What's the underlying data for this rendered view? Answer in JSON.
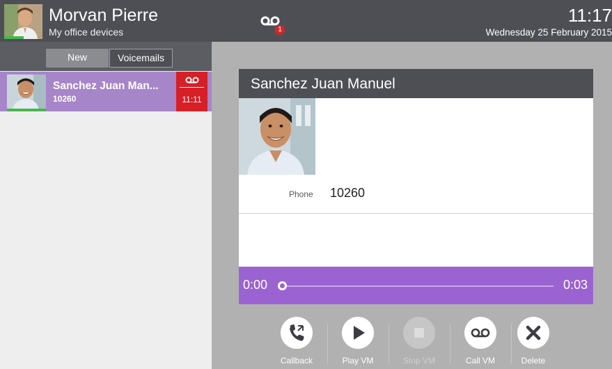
{
  "header": {
    "user_name": "Morvan Pierre",
    "user_subtitle": "My office devices",
    "voicemail_count": "1",
    "time": "11:17",
    "date": "Wednesday 25 February 2015"
  },
  "tabs": [
    {
      "label": "New",
      "selected": false
    },
    {
      "label": "Voicemails",
      "selected": true
    }
  ],
  "voicemail_list": [
    {
      "name": "Sanchez Juan Man...",
      "number": "10260",
      "time": "11:11"
    }
  ],
  "detail": {
    "title": "Sanchez Juan Manuel",
    "phone_label": "Phone",
    "phone_value": "10260"
  },
  "player": {
    "start_time": "0:00",
    "end_time": "0:03",
    "progress": 0
  },
  "actions": [
    {
      "label": "Callback",
      "icon": "callback-icon",
      "enabled": true
    },
    {
      "label": "Play VM",
      "icon": "play-icon",
      "enabled": true
    },
    {
      "label": "Stop VM",
      "icon": "stop-icon",
      "enabled": false
    },
    {
      "label": "Call VM",
      "icon": "voicemail-icon",
      "enabled": true
    },
    {
      "label": "Delete",
      "icon": "close-icon",
      "enabled": true
    }
  ],
  "colors": {
    "header": "#4d4f55",
    "accent_purple": "#9b63d1",
    "list_item_purple": "#a785c9",
    "badge_red": "#d61f26",
    "presence_green": "#46b84a"
  }
}
